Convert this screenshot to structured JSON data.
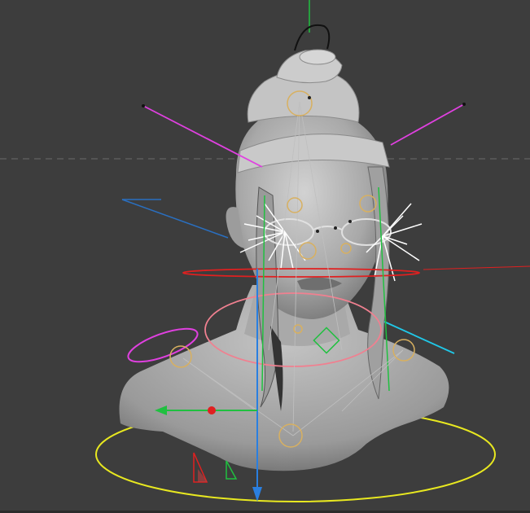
{
  "viewport": {
    "label": "",
    "background": "#3d3d3d"
  },
  "colors": {
    "model": "#b8b8b8",
    "model_shadow": "#8c8c8c",
    "axis_x": "#e02020",
    "axis_y": "#20c040",
    "axis_z": "#2a7fe0",
    "ctrl_magenta": "#e040e0",
    "ctrl_yellow": "#e8e820",
    "ctrl_pink": "#f08090",
    "ctrl_cyan": "#20c8e8",
    "bone_orange": "#d8b060",
    "rig_white": "#ffffff"
  },
  "icons": {
    "gizmo": "transform-gizmo-icon",
    "root": "root-control-icon"
  }
}
